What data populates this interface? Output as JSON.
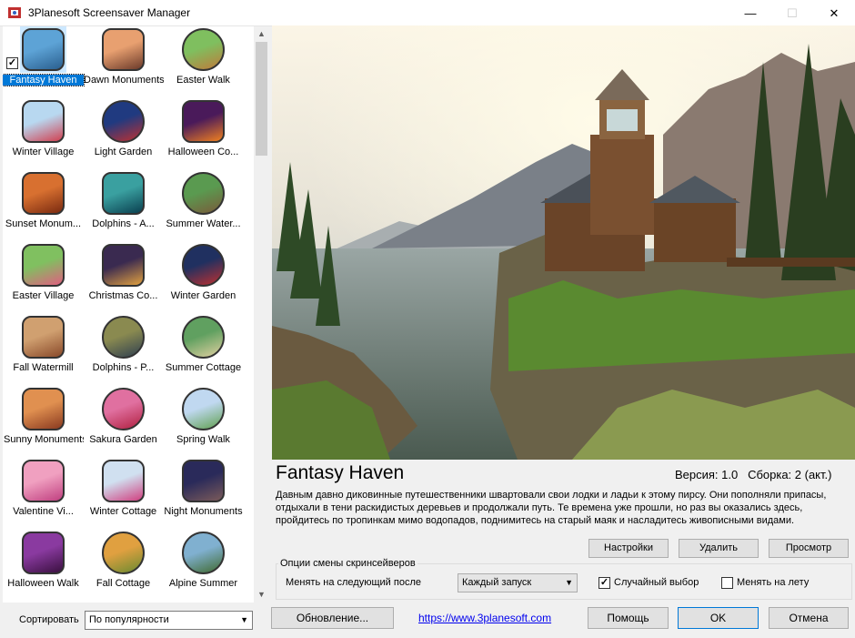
{
  "window": {
    "title": "3Planesoft Screensaver Manager",
    "minimize_glyph": "—",
    "maximize_glyph": "☐",
    "close_glyph": "✕"
  },
  "screensavers": [
    {
      "name": "Fantasy Haven",
      "c1": "#5da3d6",
      "c2": "#2a5f8f",
      "selected": true,
      "checked": true
    },
    {
      "name": "Dawn Monuments",
      "c1": "#e8a070",
      "c2": "#6b3a2a"
    },
    {
      "name": "Easter Walk",
      "c1": "#7fbf5f",
      "c2": "#c07a3a",
      "round": true
    },
    {
      "name": "Winter Village",
      "c1": "#b8d8f0",
      "c2": "#d04050"
    },
    {
      "name": "Light Garden",
      "c1": "#203a80",
      "c2": "#c03030",
      "round": true
    },
    {
      "name": "Halloween Co...",
      "c1": "#4a1a5a",
      "c2": "#f08020"
    },
    {
      "name": "Sunset Monum...",
      "c1": "#d87030",
      "c2": "#7a2a10"
    },
    {
      "name": "Dolphins - A...",
      "c1": "#3aa0a0",
      "c2": "#0a4050"
    },
    {
      "name": "Summer Water...",
      "c1": "#5a9a50",
      "c2": "#7a5a3a",
      "round": true
    },
    {
      "name": "Easter Village",
      "c1": "#80c060",
      "c2": "#e06080"
    },
    {
      "name": "Christmas Co...",
      "c1": "#3a2a50",
      "c2": "#e0a040"
    },
    {
      "name": "Winter Garden",
      "c1": "#203060",
      "c2": "#c03030",
      "round": true
    },
    {
      "name": "Fall Watermill",
      "c1": "#d0a070",
      "c2": "#8a4a2a"
    },
    {
      "name": "Dolphins - P...",
      "c1": "#8a8a50",
      "c2": "#304050",
      "round": true
    },
    {
      "name": "Summer Cottage",
      "c1": "#60a060",
      "c2": "#e0d0a0",
      "round": true
    },
    {
      "name": "Sunny Monuments",
      "c1": "#e09050",
      "c2": "#8a3a20"
    },
    {
      "name": "Sakura Garden",
      "c1": "#e070a0",
      "c2": "#b02040",
      "round": true
    },
    {
      "name": "Spring Walk",
      "c1": "#c0d8f0",
      "c2": "#60a050",
      "round": true
    },
    {
      "name": "Valentine Vi...",
      "c1": "#f0a0c0",
      "c2": "#c04080"
    },
    {
      "name": "Winter Cottage",
      "c1": "#d0e0f0",
      "c2": "#d04080"
    },
    {
      "name": "Night Monuments",
      "c1": "#2a2a5a",
      "c2": "#7a5a5a"
    },
    {
      "name": "Halloween Walk",
      "c1": "#8a3aa0",
      "c2": "#3a1040"
    },
    {
      "name": "Fall Cottage",
      "c1": "#e0a040",
      "c2": "#6a8a30",
      "round": true
    },
    {
      "name": "Alpine Summer",
      "c1": "#80b0d0",
      "c2": "#406a30",
      "round": true
    }
  ],
  "sort": {
    "label": "Сортировать",
    "value": "По популярности"
  },
  "details": {
    "title": "Fantasy Haven",
    "version": "Версия: 1.0   Сборка: 2 (акт.)",
    "description": "Давным давно диковинные путешественники швартовали свои лодки и ладьи к этому пирсу. Они пополняли припасы, отдыхали в тени раскидистых деревьев и продолжали путь. Те времена уже прошли, но раз вы оказались здесь, пройдитесь по тропинкам мимо водопадов, поднимитесь на старый маяк и насладитесь живописными видами."
  },
  "actions": {
    "settings": "Настройки",
    "delete": "Удалить",
    "preview": "Просмотр"
  },
  "options": {
    "group_title": "Опции смены скринсейверов",
    "change_label": "Менять на следующий после",
    "change_value": "Каждый запуск",
    "random_label": "Случайный выбор",
    "random_checked": true,
    "onfly_label": "Менять на лету",
    "onfly_checked": false
  },
  "footer": {
    "update": "Обновление...",
    "link": "https://www.3planesoft.com",
    "help": "Помощь",
    "ok": "OK",
    "cancel": "Отмена"
  },
  "colors": {
    "accent": "#0078d7",
    "link": "#0000ee"
  }
}
